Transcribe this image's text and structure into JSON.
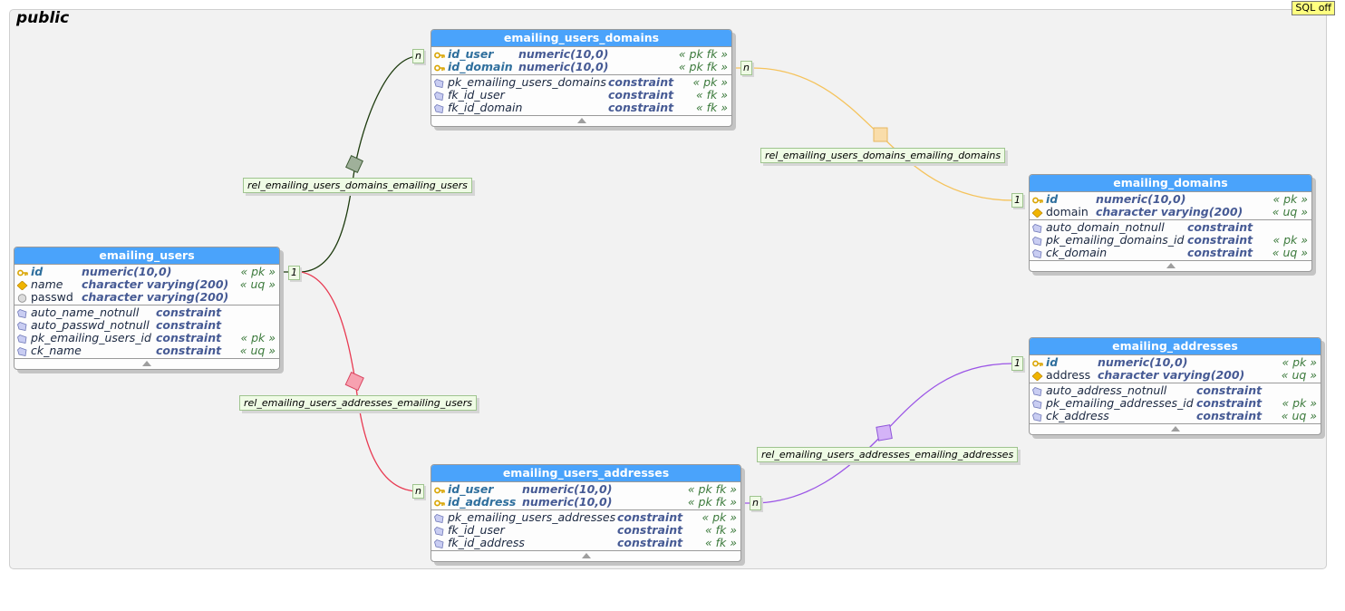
{
  "schema": {
    "title": "public",
    "sql_toggle_label": "SQL off"
  },
  "tables": {
    "emailing_users": {
      "title": "emailing_users",
      "columns": [
        {
          "name": "id",
          "type": "numeric(10,0)",
          "stereotype": "« pk »"
        },
        {
          "name": "name",
          "type": "character varying(200)",
          "stereotype": "« uq »"
        },
        {
          "name": "passwd",
          "type": "character varying(200)",
          "stereotype": ""
        }
      ],
      "constraints": [
        {
          "name": "auto_name_notnull",
          "type": "constraint",
          "stereotype": ""
        },
        {
          "name": "auto_passwd_notnull",
          "type": "constraint",
          "stereotype": ""
        },
        {
          "name": "pk_emailing_users_id",
          "type": "constraint",
          "stereotype": "« pk »"
        },
        {
          "name": "ck_name",
          "type": "constraint",
          "stereotype": "« uq »"
        }
      ]
    },
    "emailing_users_domains": {
      "title": "emailing_users_domains",
      "columns": [
        {
          "name": "id_user",
          "type": "numeric(10,0)",
          "stereotype": "« pk fk »"
        },
        {
          "name": "id_domain",
          "type": "numeric(10,0)",
          "stereotype": "« pk fk »"
        }
      ],
      "constraints": [
        {
          "name": "pk_emailing_users_domains",
          "type": "constraint",
          "stereotype": "« pk »"
        },
        {
          "name": "fk_id_user",
          "type": "constraint",
          "stereotype": "« fk »"
        },
        {
          "name": "fk_id_domain",
          "type": "constraint",
          "stereotype": "« fk »"
        }
      ]
    },
    "emailing_domains": {
      "title": "emailing_domains",
      "columns": [
        {
          "name": "id",
          "type": "numeric(10,0)",
          "stereotype": "« pk »"
        },
        {
          "name": "domain",
          "type": "character varying(200)",
          "stereotype": "« uq »"
        }
      ],
      "constraints": [
        {
          "name": "auto_domain_notnull",
          "type": "constraint",
          "stereotype": ""
        },
        {
          "name": "pk_emailing_domains_id",
          "type": "constraint",
          "stereotype": "« pk »"
        },
        {
          "name": "ck_domain",
          "type": "constraint",
          "stereotype": "« uq »"
        }
      ]
    },
    "emailing_addresses": {
      "title": "emailing_addresses",
      "columns": [
        {
          "name": "id",
          "type": "numeric(10,0)",
          "stereotype": "« pk »"
        },
        {
          "name": "address",
          "type": "character varying(200)",
          "stereotype": "« uq »"
        }
      ],
      "constraints": [
        {
          "name": "auto_address_notnull",
          "type": "constraint",
          "stereotype": ""
        },
        {
          "name": "pk_emailing_addresses_id",
          "type": "constraint",
          "stereotype": "« pk »"
        },
        {
          "name": "ck_address",
          "type": "constraint",
          "stereotype": "« uq »"
        }
      ]
    },
    "emailing_users_addresses": {
      "title": "emailing_users_addresses",
      "columns": [
        {
          "name": "id_user",
          "type": "numeric(10,0)",
          "stereotype": "« pk fk »"
        },
        {
          "name": "id_address",
          "type": "numeric(10,0)",
          "stereotype": "« pk fk »"
        }
      ],
      "constraints": [
        {
          "name": "pk_emailing_users_addresses",
          "type": "constraint",
          "stereotype": "« pk »"
        },
        {
          "name": "fk_id_user",
          "type": "constraint",
          "stereotype": "« fk »"
        },
        {
          "name": "fk_id_address",
          "type": "constraint",
          "stereotype": "« fk »"
        }
      ]
    }
  },
  "relationships": [
    {
      "label": "rel_emailing_users_domains_emailing_users",
      "from_card": "1",
      "to_card": "n",
      "color": "#1d3b0e"
    },
    {
      "label": "rel_emailing_users_domains_emailing_domains",
      "from_card": "1",
      "to_card": "n",
      "color": "#f5c35c"
    },
    {
      "label": "rel_emailing_users_addresses_emailing_users",
      "from_card": "1",
      "to_card": "n",
      "color": "#e83a52"
    },
    {
      "label": "rel_emailing_users_addresses_emailing_addresses",
      "from_card": "1",
      "to_card": "n",
      "color": "#9b55e6"
    }
  ],
  "colors": {
    "header": "#4aa3fb",
    "pk_name": "#2f6f9d",
    "type": "#465a94",
    "stereotype": "#3c7a3c",
    "label_bg": "#effbe5"
  }
}
